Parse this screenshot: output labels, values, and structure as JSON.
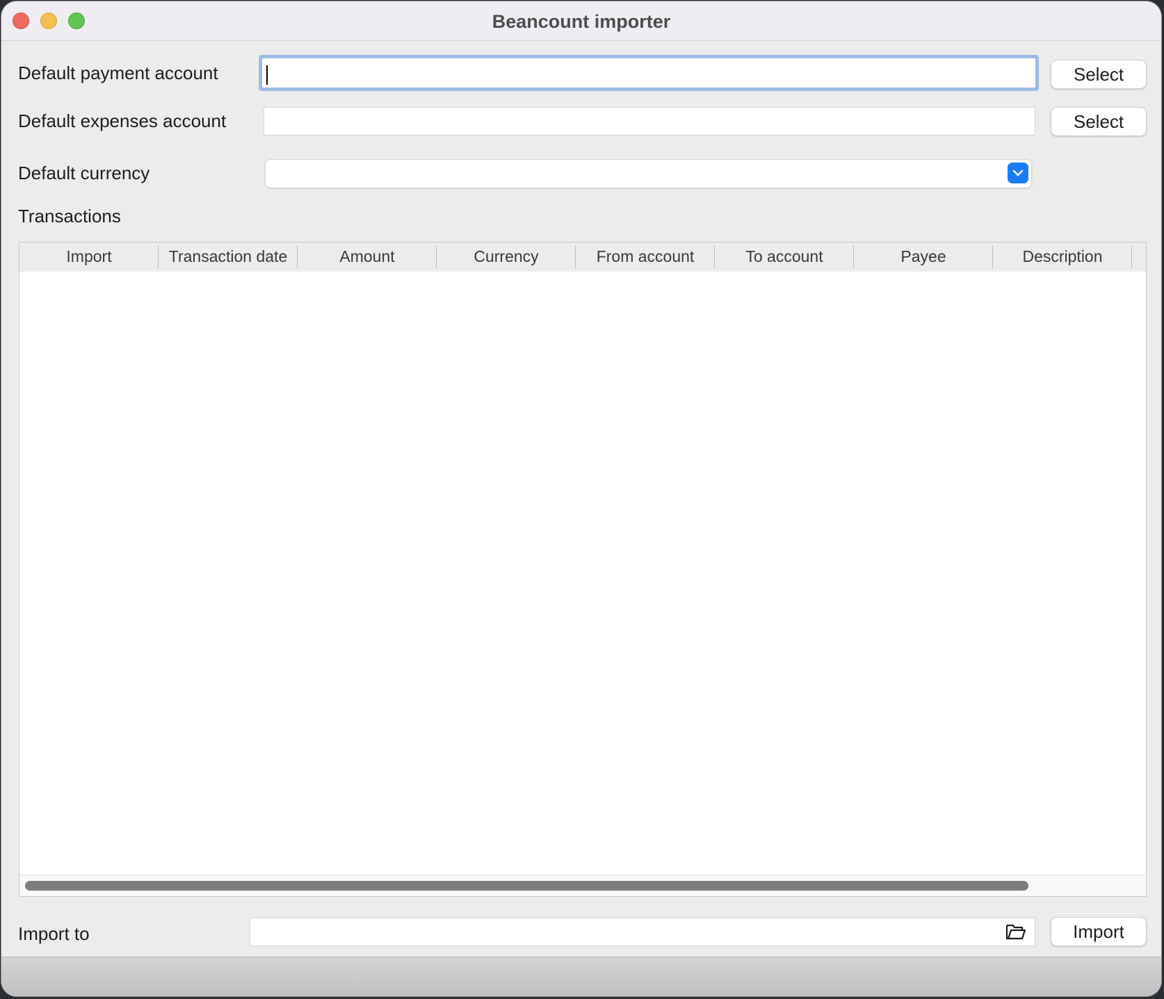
{
  "window": {
    "title": "Beancount importer"
  },
  "form": {
    "payment_account": {
      "label": "Default payment account",
      "value": "",
      "button_label": "Select"
    },
    "expenses_account": {
      "label": "Default expenses account",
      "value": "",
      "button_label": "Select"
    },
    "currency": {
      "label": "Default currency",
      "selected": ""
    }
  },
  "transactions": {
    "section_label": "Transactions",
    "columns": [
      "Import",
      "Transaction date",
      "Amount",
      "Currency",
      "From account",
      "To account",
      "Payee",
      "Description"
    ],
    "rows": []
  },
  "import_to": {
    "label": "Import to",
    "value": "",
    "button_label": "Import"
  },
  "icons": {
    "folder": "folder-open-icon",
    "dropdown": "chevron-down-icon"
  },
  "colors": {
    "accent": "#1a7cf5",
    "focus_ring": "#9dbbe8",
    "close": "#ee6a5e",
    "minimize": "#f5bf4f",
    "maximize": "#61c554"
  }
}
